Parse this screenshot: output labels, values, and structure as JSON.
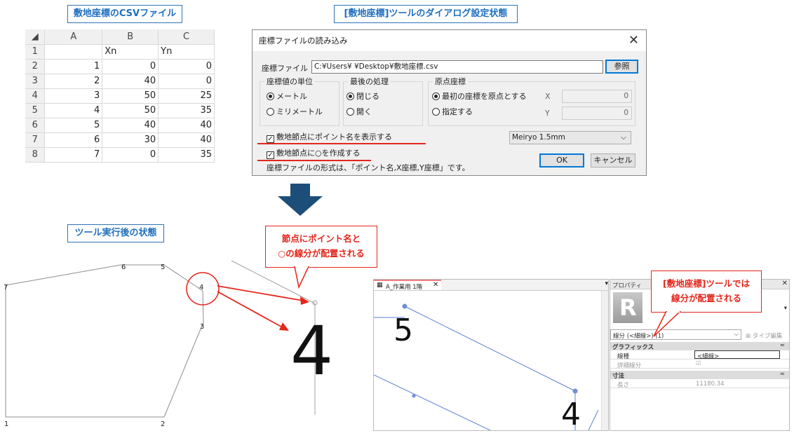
{
  "labels": {
    "csv_title": "敷地座標のCSVファイル",
    "dialog_state_title": "[敷地座標]ツールのダイアログ設定状態",
    "after_title": "ツール実行後の状態"
  },
  "sheet": {
    "columns": [
      "A",
      "B",
      "C"
    ],
    "rows": [
      {
        "n": "1",
        "a": "",
        "b": "Xn",
        "c": "Yn"
      },
      {
        "n": "2",
        "a": "1",
        "b": "0",
        "c": "0"
      },
      {
        "n": "3",
        "a": "2",
        "b": "40",
        "c": "0"
      },
      {
        "n": "4",
        "a": "3",
        "b": "50",
        "c": "25"
      },
      {
        "n": "5",
        "a": "4",
        "b": "50",
        "c": "35"
      },
      {
        "n": "6",
        "a": "5",
        "b": "40",
        "c": "40"
      },
      {
        "n": "7",
        "a": "6",
        "b": "30",
        "c": "40"
      },
      {
        "n": "8",
        "a": "7",
        "b": "0",
        "c": "35"
      }
    ]
  },
  "dialog": {
    "title": "座標ファイルの読み込み",
    "file_label": "座標ファイル",
    "file_path": "C:¥Users¥                    ¥Desktop¥敷地座標.csv",
    "browse": "参照",
    "unit_group": "座標値の単位",
    "unit_meter": "メートル",
    "unit_mm": "ミリメートル",
    "last_group": "最後の処理",
    "last_close": "閉じる",
    "last_open": "開く",
    "origin_group": "原点座標",
    "origin_first": "最初の座標を原点とする",
    "origin_specify": "指定する",
    "x_label": "X",
    "y_label": "Y",
    "x_value": "0",
    "y_value": "0",
    "check_names": "敷地節点にポイント名を表示する",
    "check_circles": "敷地節点に○を作成する",
    "font_select": "Meiryo 1.5mm",
    "format_note": "座標ファイルの形式は、「ポイント名,X座標,Y座標」です。",
    "ok": "OK",
    "cancel": "キャンセル"
  },
  "callouts": {
    "left_line1": "節点にポイント名と",
    "left_line2": "○の線分が配置される",
    "right_line1": "[敷地座標]ツールでは",
    "right_line2": "線分が配置される"
  },
  "plan": {
    "point_labels": [
      "1",
      "2",
      "3",
      "4",
      "5",
      "6",
      "7"
    ],
    "big_label": "4"
  },
  "revit": {
    "tab_title": "A_作業用 1階",
    "props_title": "プロパティ",
    "type_select": "線分 (<細線>) (1)",
    "edit_type": "タイプ編集",
    "graphics": "グラフィックス",
    "line_style_label": "線種",
    "line_style_value": "<細線>",
    "detail_line_label": "詳細線分",
    "dimensions": "寸法",
    "length_label": "長さ",
    "length_value": "11180.34",
    "view_label_5": "5",
    "view_label_4": "4",
    "logo": "R"
  },
  "colors": {
    "accent_blue": "#1f6fbf",
    "callout_red": "#e5261c",
    "arrow_navy": "#1d4e79",
    "revit_line": "#5b7fd4"
  }
}
